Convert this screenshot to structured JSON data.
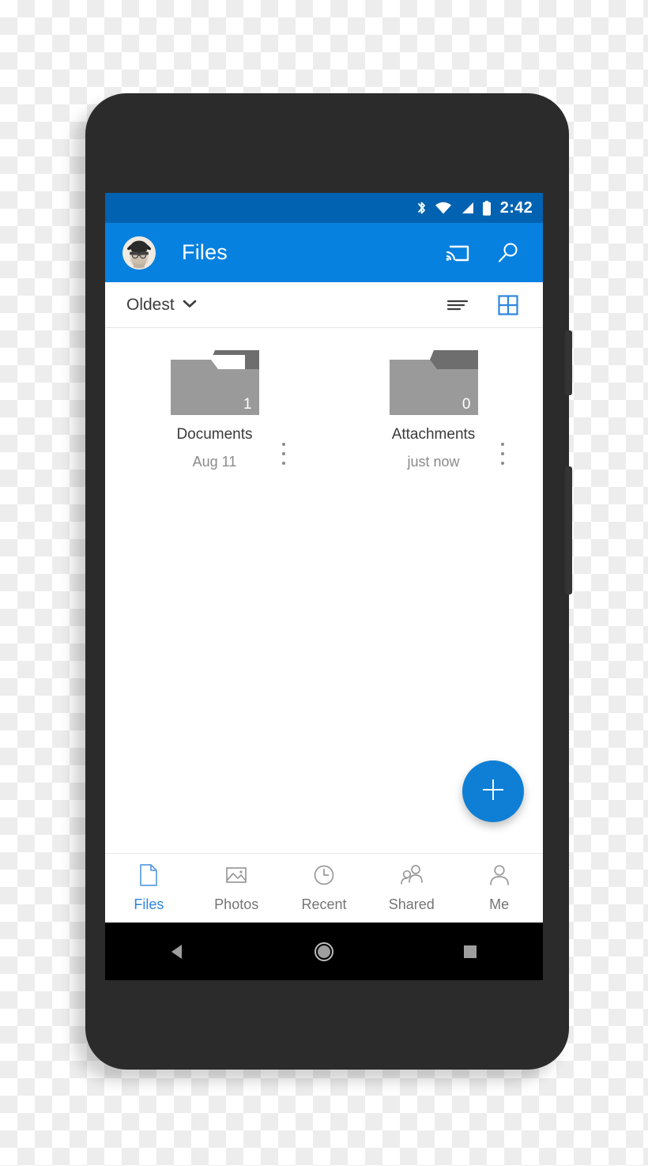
{
  "device": {
    "camera_icon": "camera-dot",
    "speaker_icon": "speaker-grille",
    "sensor_icon": "proximity-sensor",
    "power_button": "power-button",
    "volume_button": "volume-rocker"
  },
  "status_bar": {
    "time": "2:42",
    "icons": [
      "bluetooth-icon",
      "wifi-icon",
      "cellular-signal-icon",
      "battery-icon"
    ],
    "background_color": "#0062B1",
    "foreground_color": "#FFFFFF"
  },
  "app_bar": {
    "title": "Files",
    "avatar_icon": "avatar",
    "cast_label": "cast-icon",
    "search_label": "search-icon",
    "background_color": "#0681E0"
  },
  "sort_bar": {
    "sort_value": "Oldest",
    "chevron_icon": "chevron-down-icon",
    "list_view_icon": "list-view-icon",
    "grid_view_icon": "grid-view-icon",
    "active_view": "grid",
    "active_color": "#2E86DE",
    "inactive_color": "#3C3C3C"
  },
  "files": [
    {
      "name": "Documents",
      "date": "Aug 11",
      "count": "1",
      "type": "folder-with-document",
      "overflow_icon": "overflow-menu-icon"
    },
    {
      "name": "Attachments",
      "date": "just now",
      "count": "0",
      "type": "folder",
      "overflow_icon": "overflow-menu-icon"
    }
  ],
  "fab": {
    "icon": "plus-icon",
    "label": "Add",
    "color": "#0E7FD4"
  },
  "bottom_nav": {
    "active_index": 0,
    "active_color": "#2E86DE",
    "inactive_color": "#757575",
    "items": [
      {
        "label": "Files",
        "icon": "document-icon"
      },
      {
        "label": "Photos",
        "icon": "photo-icon"
      },
      {
        "label": "Recent",
        "icon": "clock-icon"
      },
      {
        "label": "Shared",
        "icon": "people-icon"
      },
      {
        "label": "Me",
        "icon": "person-icon"
      }
    ]
  },
  "android_nav": {
    "back_icon": "back-triangle-icon",
    "home_icon": "home-circle-icon",
    "recents_icon": "recents-square-icon"
  }
}
